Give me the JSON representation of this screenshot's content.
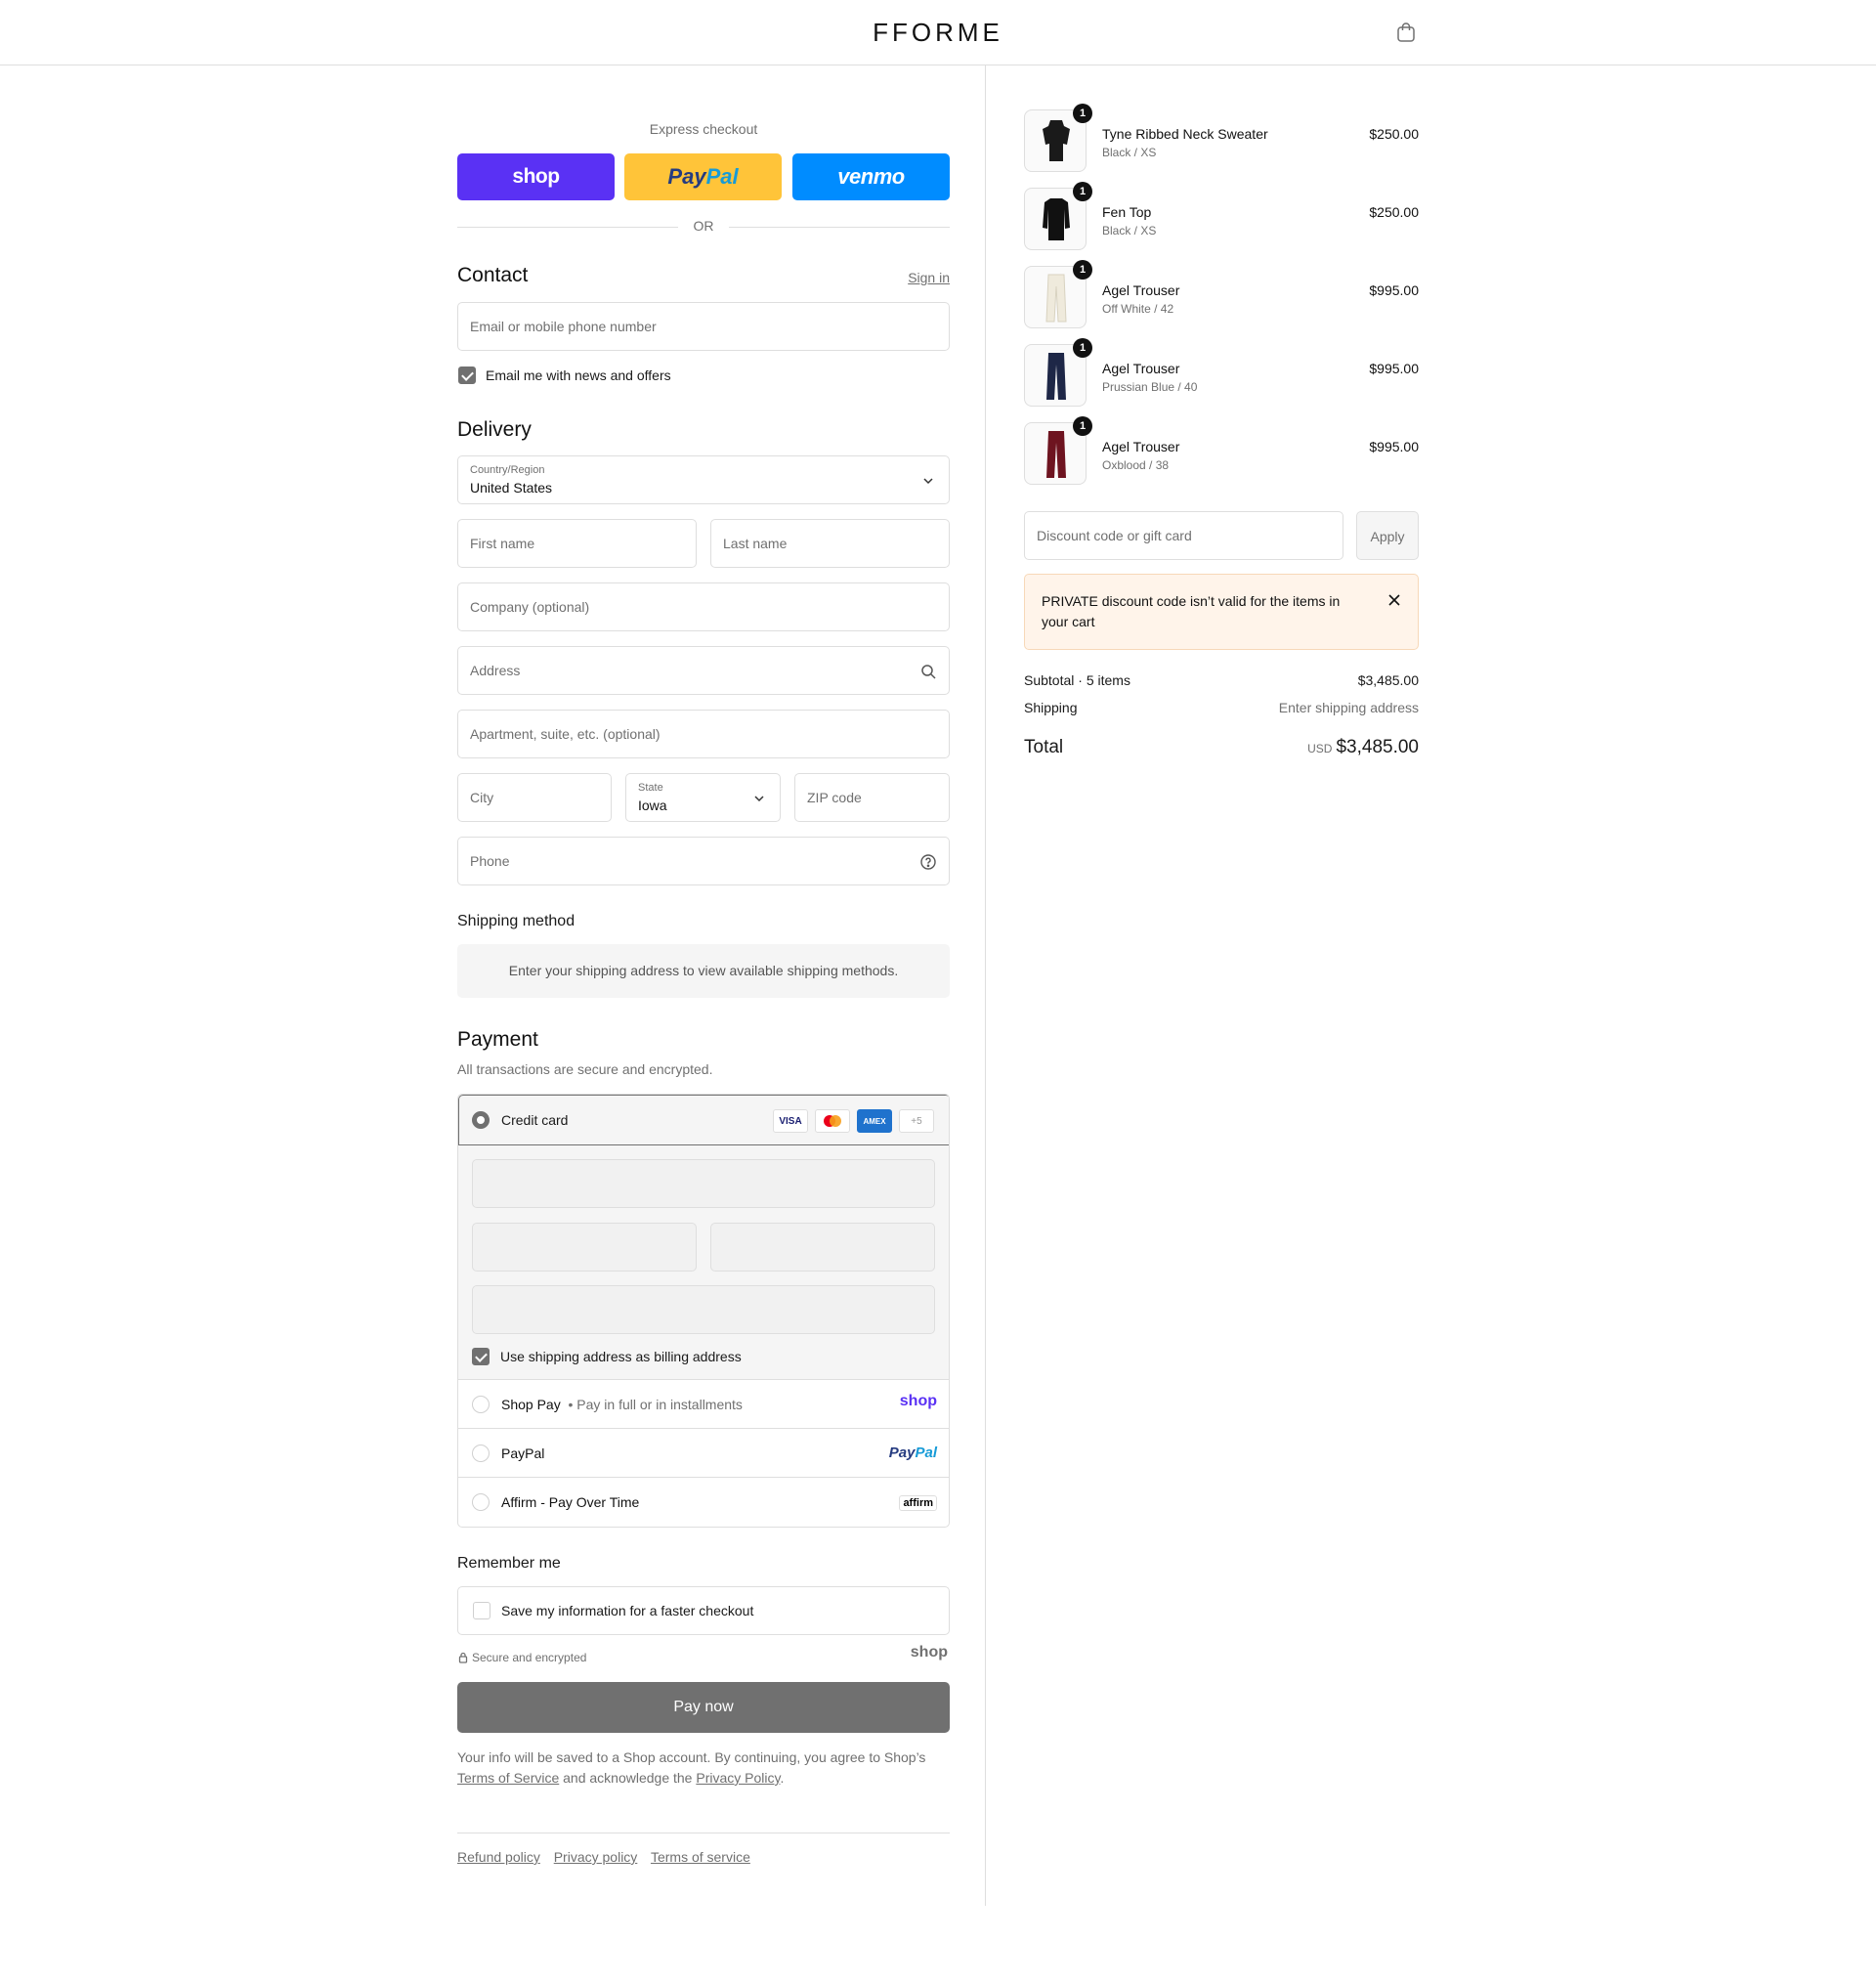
{
  "header": {
    "brand": "FFORME",
    "cart_icon": "bag-icon"
  },
  "express": {
    "title": "Express checkout",
    "shop_label": "shop",
    "paypal_label_1": "Pay",
    "paypal_label_2": "Pal",
    "venmo_label": "venmo",
    "or": "OR"
  },
  "contact": {
    "title": "Contact",
    "sign_in": "Sign in",
    "email_placeholder": "Email or mobile phone number",
    "news_label": "Email me with news and offers",
    "news_checked": true
  },
  "delivery": {
    "title": "Delivery",
    "country_label": "Country/Region",
    "country_value": "United States",
    "first_name": "First name",
    "last_name": "Last name",
    "company": "Company (optional)",
    "address": "Address",
    "apartment": "Apartment, suite, etc. (optional)",
    "city": "City",
    "state_label": "State",
    "state_value": "Iowa",
    "zip": "ZIP code",
    "phone": "Phone"
  },
  "shipping_method": {
    "title": "Shipping method",
    "message": "Enter your shipping address to view available shipping methods."
  },
  "payment": {
    "title": "Payment",
    "subtitle": "All transactions are secure and encrypted.",
    "credit_card": "Credit card",
    "card_logos": [
      "VISA",
      "MC",
      "AMEX",
      "+5"
    ],
    "billing_label": "Use shipping address as billing address",
    "shop_pay": "Shop Pay",
    "shop_pay_sub": "Pay in full or in installments",
    "shop_pay_logo": "shop",
    "paypal": "PayPal",
    "paypal_logo_1": "Pay",
    "paypal_logo_2": "Pal",
    "affirm": "Affirm - Pay Over Time",
    "affirm_logo": "affirm"
  },
  "remember": {
    "title": "Remember me",
    "save_label": "Save my information for a faster checkout",
    "secure": "Secure and encrypted",
    "shop_logo": "shop"
  },
  "pay_now": "Pay now",
  "legal": {
    "text_1": "Your info will be saved to a Shop account. By continuing, you agree to Shop’s",
    "terms": "Terms of Service",
    "text_2": "and acknowledge the",
    "privacy": "Privacy Policy",
    "text_3": "."
  },
  "footer": {
    "refund": "Refund policy",
    "privacy": "Privacy policy",
    "terms": "Terms of service"
  },
  "cart": {
    "items": [
      {
        "name": "Tyne Ribbed Neck Sweater",
        "variant": "Black / XS",
        "price": "$250.00",
        "qty": "1",
        "color": "#1a1a1a"
      },
      {
        "name": "Fen Top",
        "variant": "Black / XS",
        "price": "$250.00",
        "qty": "1",
        "color": "#111111"
      },
      {
        "name": "Agel Trouser",
        "variant": "Off White / 42",
        "price": "$995.00",
        "qty": "1",
        "color": "#efeadc"
      },
      {
        "name": "Agel Trouser",
        "variant": "Prussian Blue / 40",
        "price": "$995.00",
        "qty": "1",
        "color": "#1e2747"
      },
      {
        "name": "Agel Trouser",
        "variant": "Oxblood / 38",
        "price": "$995.00",
        "qty": "1",
        "color": "#6e1420"
      }
    ],
    "discount_placeholder": "Discount code or gift card",
    "apply": "Apply",
    "notice": "PRIVATE discount code isn’t valid for the items in your cart",
    "subtotal_label": "Subtotal · 5 items",
    "subtotal_value": "$3,485.00",
    "shipping_label": "Shipping",
    "shipping_value": "Enter shipping address",
    "total_label": "Total",
    "total_currency": "USD",
    "total_value": "$3,485.00"
  }
}
